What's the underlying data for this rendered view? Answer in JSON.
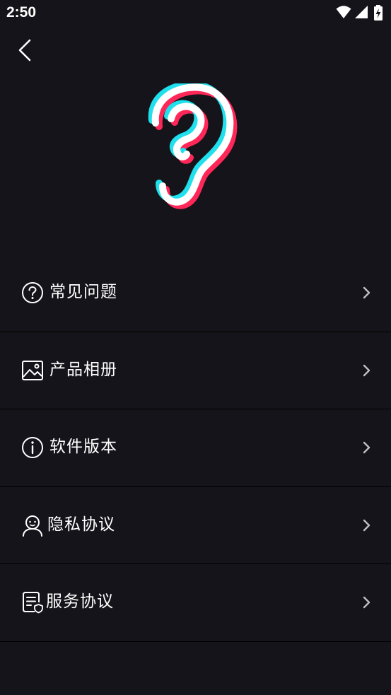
{
  "status_bar": {
    "time": "2:50",
    "icons": [
      "wifi-icon",
      "signal-icon",
      "battery-charging-icon"
    ]
  },
  "header": {
    "back_icon": "chevron-left-icon"
  },
  "logo": {
    "icon": "ear-logo-icon",
    "colors": {
      "cyan": "#1fe0ec",
      "red": "#ff2757",
      "white": "#ffffff"
    }
  },
  "menu": {
    "items": [
      {
        "icon": "question-circle-icon",
        "label": "常见问题"
      },
      {
        "icon": "image-icon",
        "label": "产品相册"
      },
      {
        "icon": "info-circle-icon",
        "label": "软件版本"
      },
      {
        "icon": "user-icon",
        "label": "隐私协议"
      },
      {
        "icon": "document-shield-icon",
        "label": "服务协议"
      }
    ]
  },
  "colors": {
    "background": "#15141a",
    "divider": "#000000",
    "text": "#ffffff",
    "chevron": "#bfbfbf"
  }
}
